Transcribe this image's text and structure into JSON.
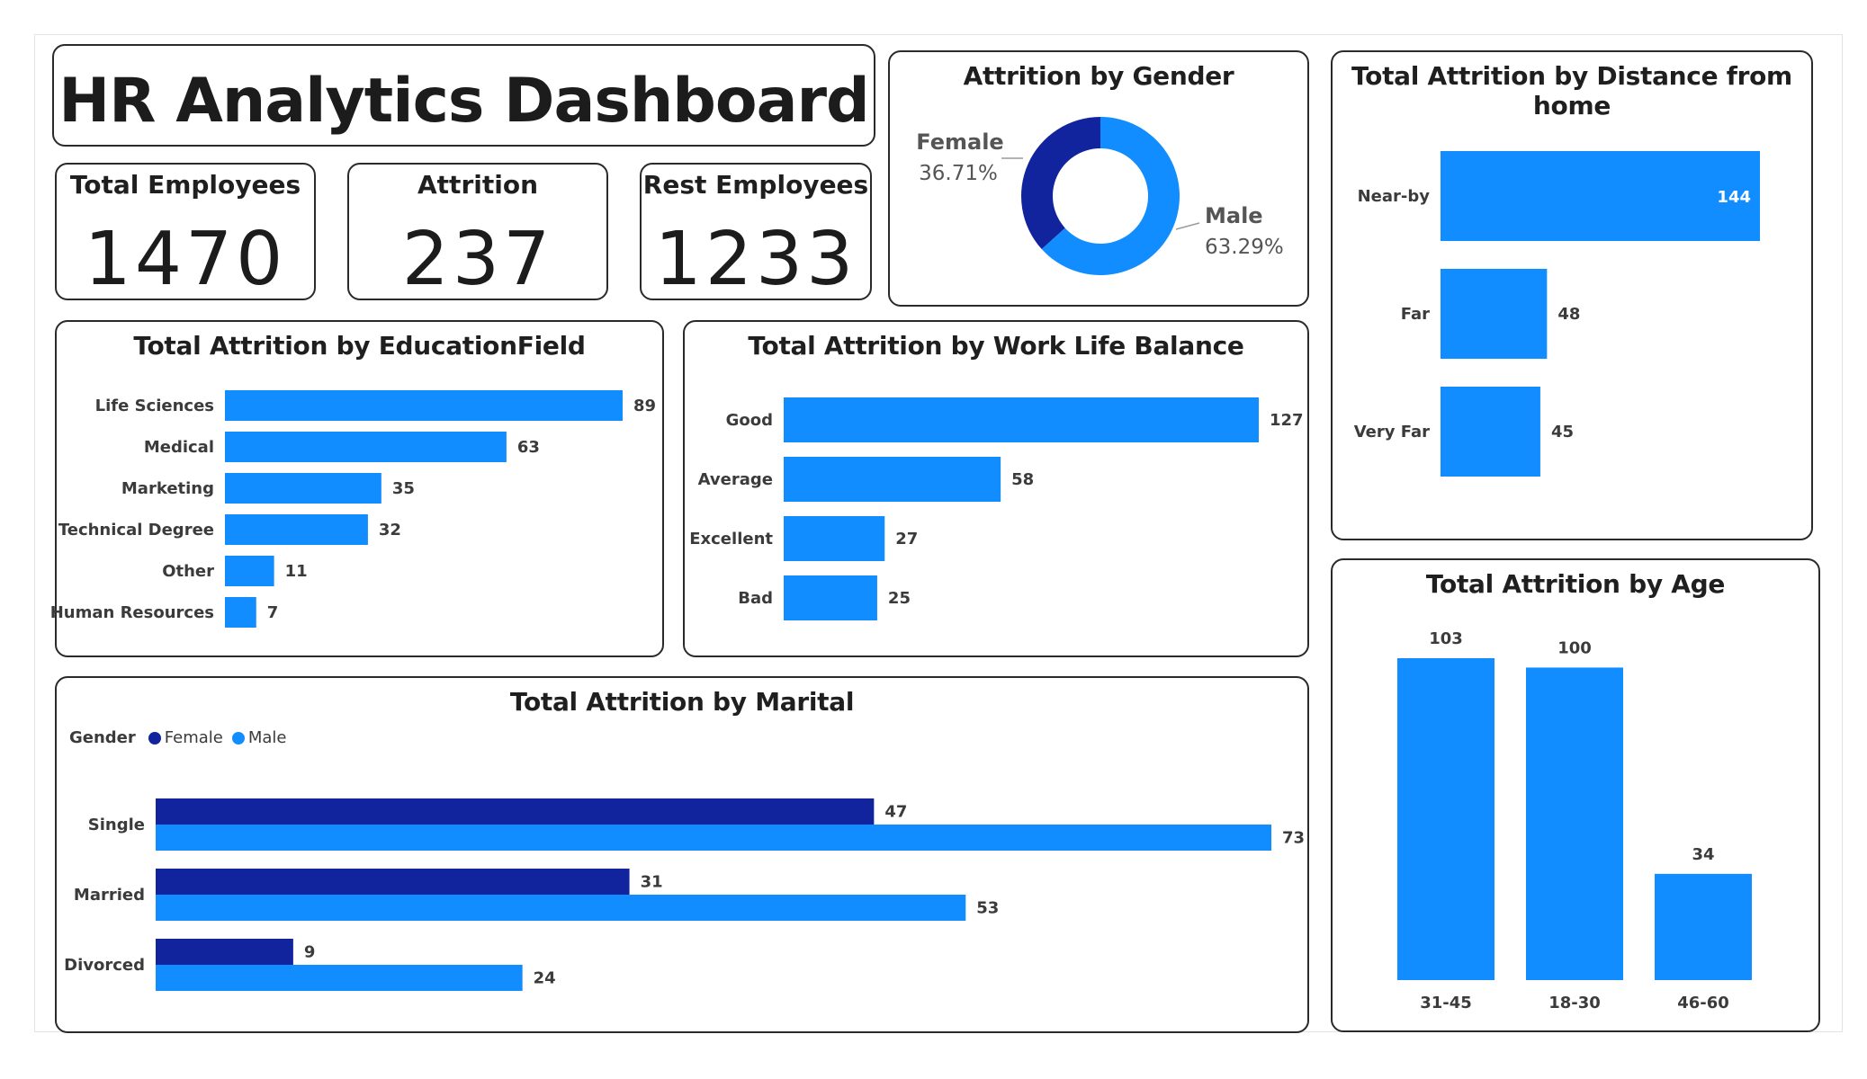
{
  "dashboard": {
    "title": "HR Analytics Dashboard"
  },
  "kpis": {
    "total_employees": {
      "label": "Total Employees",
      "value": "1470"
    },
    "attrition": {
      "label": "Attrition",
      "value": "237"
    },
    "rest_employees": {
      "label": "Rest Employees",
      "value": "1233"
    }
  },
  "colors": {
    "male": "#118DFF",
    "female": "#12239E",
    "bar": "#118DFF"
  },
  "chart_data": [
    {
      "id": "gender",
      "type": "pie",
      "donut": true,
      "title": "Attrition by Gender",
      "categories": [
        "Female",
        "Male"
      ],
      "values": [
        36.71,
        63.29
      ],
      "value_labels": [
        "36.71%",
        "63.29%"
      ]
    },
    {
      "id": "distance",
      "type": "bar",
      "orientation": "horizontal",
      "title": "Total Attrition by Distance from home",
      "categories": [
        "Near-by",
        "Far",
        "Very Far"
      ],
      "values": [
        144,
        48,
        45
      ]
    },
    {
      "id": "education",
      "type": "bar",
      "orientation": "horizontal",
      "title": "Total Attrition by EducationField",
      "categories": [
        "Life Sciences",
        "Medical",
        "Marketing",
        "Technical Degree",
        "Other",
        "Human Resources"
      ],
      "values": [
        89,
        63,
        35,
        32,
        11,
        7
      ]
    },
    {
      "id": "worklife",
      "type": "bar",
      "orientation": "horizontal",
      "title": "Total Attrition by Work Life Balance",
      "categories": [
        "Good",
        "Average",
        "Excellent",
        "Bad"
      ],
      "values": [
        127,
        58,
        27,
        25
      ]
    },
    {
      "id": "marital",
      "type": "bar",
      "orientation": "horizontal",
      "title": "Total Attrition by Marital",
      "legend_title": "Gender",
      "categories": [
        "Single",
        "Married",
        "Divorced"
      ],
      "series": [
        {
          "name": "Female",
          "values": [
            47,
            31,
            9
          ]
        },
        {
          "name": "Male",
          "values": [
            73,
            53,
            24
          ]
        }
      ]
    },
    {
      "id": "age",
      "type": "bar",
      "orientation": "vertical",
      "title": "Total Attrition by Age",
      "categories": [
        "31-45",
        "18-30",
        "46-60"
      ],
      "values": [
        103,
        100,
        34
      ]
    }
  ]
}
